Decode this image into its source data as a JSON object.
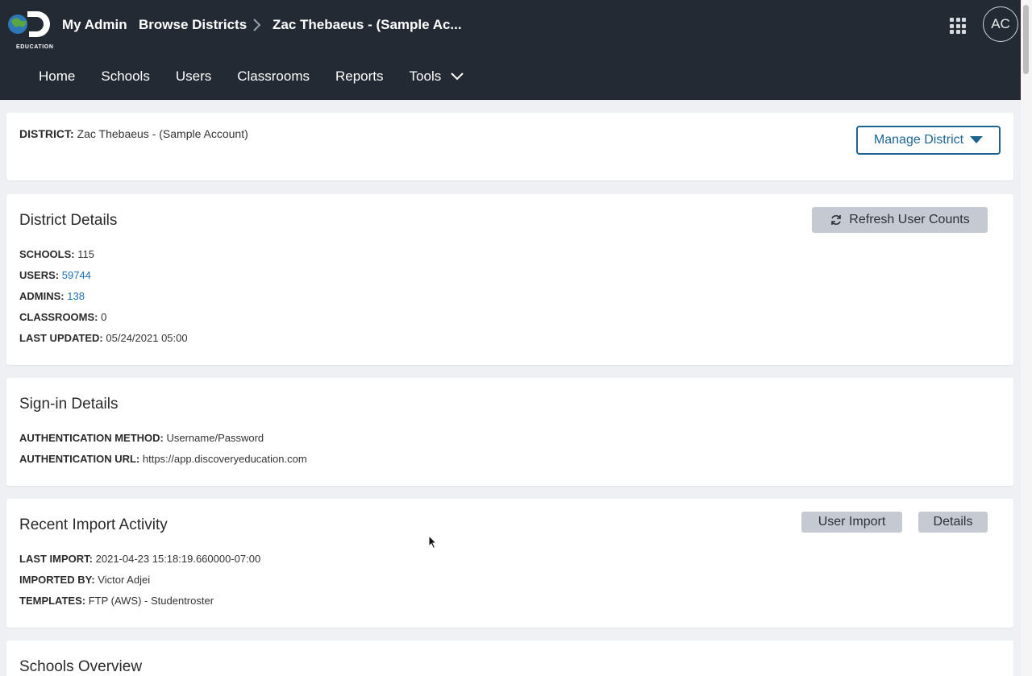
{
  "header": {
    "logo_text": "EDUCATION",
    "breadcrumb": [
      "My Admin",
      "Browse Districts",
      "Zac Thebaeus - (Sample Ac..."
    ],
    "avatar_initials": "AC"
  },
  "nav": {
    "items": [
      "Home",
      "Schools",
      "Users",
      "Classrooms",
      "Reports",
      "Tools"
    ]
  },
  "district_card": {
    "label": "DISTRICT:",
    "value": "Zac Thebaeus - (Sample Account)",
    "manage_button": "Manage District"
  },
  "district_details": {
    "title": "District Details",
    "refresh_button": "Refresh User Counts",
    "rows": [
      {
        "label": "SCHOOLS:",
        "value": "115"
      },
      {
        "label": "USERS:",
        "value": "59744"
      },
      {
        "label": "ADMINS:",
        "value": "138"
      },
      {
        "label": "CLASSROOMS:",
        "value": "0"
      },
      {
        "label": "LAST UPDATED:",
        "value": "05/24/2021 05:00"
      }
    ]
  },
  "signin_details": {
    "title": "Sign-in Details",
    "rows": [
      {
        "label": "AUTHENTICATION METHOD:",
        "value": "Username/Password"
      },
      {
        "label": "AUTHENTICATION URL:",
        "value": "https://app.discoveryeducation.com"
      }
    ]
  },
  "import_activity": {
    "title": "Recent Import Activity",
    "user_import_button": "User Import",
    "details_button": "Details",
    "rows": [
      {
        "label": "LAST IMPORT:",
        "value": "2021-04-23 15:18:19.660000-07:00"
      },
      {
        "label": "IMPORTED BY:",
        "value": "Victor Adjei"
      },
      {
        "label": "TEMPLATES:",
        "value": "FTP (AWS) - Studentroster"
      }
    ]
  },
  "schools_overview": {
    "title": "Schools Overview"
  },
  "colors": {
    "topbar": "#232a33",
    "accent": "#1d6491",
    "link": "#1f6fb2",
    "button_gray": "#c5cad2"
  }
}
